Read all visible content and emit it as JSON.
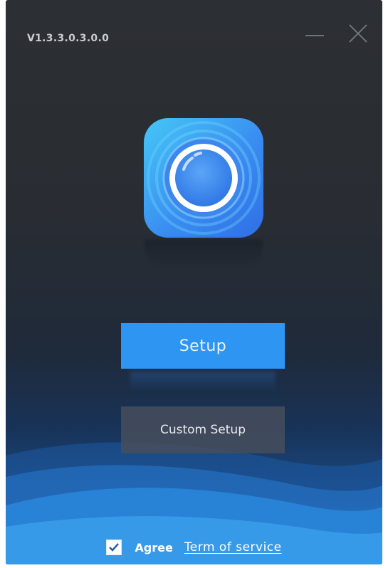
{
  "window": {
    "version": "V1.3.3.0.3.0.0"
  },
  "titlebar": {
    "minimize_icon": "minimize-icon",
    "close_icon": "close-icon"
  },
  "app": {
    "icon": "camera-lens-icon"
  },
  "actions": {
    "setup_label": "Setup",
    "custom_setup_label": "Custom Setup"
  },
  "footer": {
    "agree_checked": true,
    "agree_label": "Agree",
    "terms_link": "Term of service"
  },
  "colors": {
    "primary_button": "#2f95f3",
    "secondary_button": "#464e5c",
    "background_top": "#2c2f33",
    "wave_blue": "#2a8be0"
  }
}
